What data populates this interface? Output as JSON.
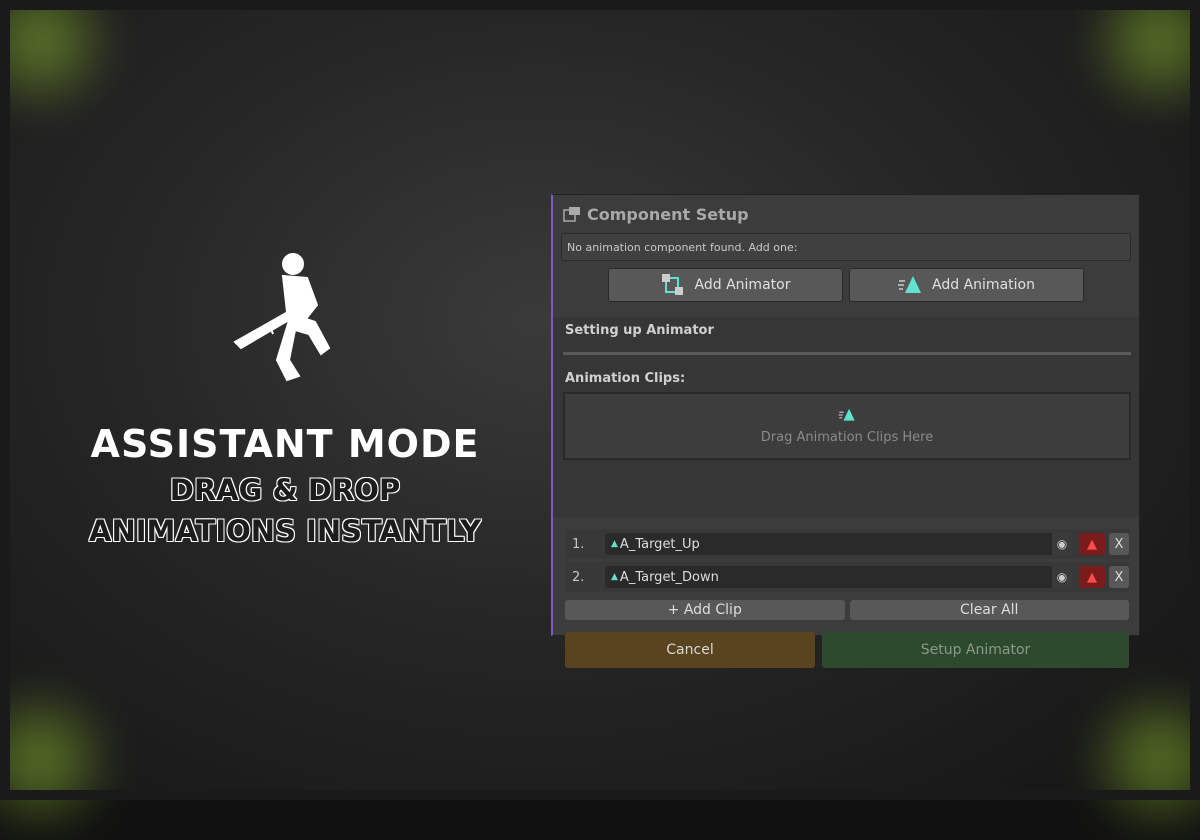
{
  "promo": {
    "title": "ASSISTANT MODE",
    "subtitle_line1": "DRAG & DROP",
    "subtitle_line2": "ANIMATIONS INSTANTLY"
  },
  "panel": {
    "title": "Component Setup",
    "message": "No animation component found. Add one:",
    "add_animator": "Add Animator",
    "add_animation": "Add Animation",
    "section_title": "Setting up Animator",
    "clips_label": "Animation Clips:",
    "drop_hint": "Drag Animation Clips Here",
    "clips": [
      {
        "index": "1.",
        "name": "A_Target_Up"
      },
      {
        "index": "2.",
        "name": "A_Target_Down"
      }
    ],
    "remove_label": "X",
    "add_clip": "+ Add Clip",
    "clear_all": "Clear All",
    "cancel": "Cancel",
    "setup": "Setup Animator"
  },
  "colors": {
    "accent": "#5fe3cf",
    "cancel": "#5a4420",
    "setup": "#2e4a2e",
    "warn": "#7a1c1c"
  }
}
